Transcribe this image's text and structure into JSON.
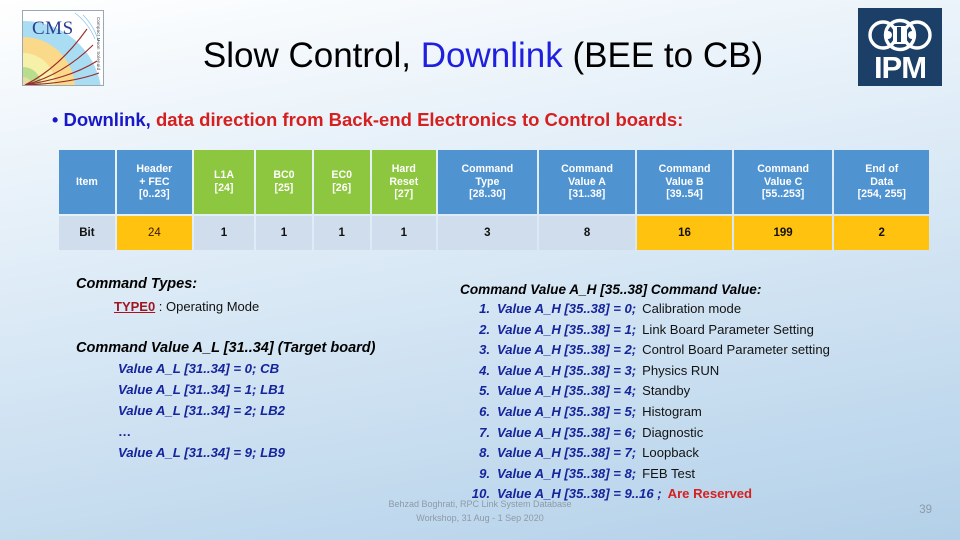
{
  "header": {
    "title_part1": "Slow Control, ",
    "title_highlight": "Downlink",
    "title_part2": " (BEE to CB)",
    "cms_logo_text": "CMS",
    "cms_logo_side_text": "Compact Muon Solenoid",
    "ipm_logo_text": "IPM"
  },
  "bullet": {
    "dot": "•",
    "blue_text": "Downlink,",
    "red_text": "data direction from Back-end Electronics to Control boards:"
  },
  "table": {
    "headers": [
      {
        "lines": [
          "Item"
        ],
        "color": "blue"
      },
      {
        "lines": [
          "Header",
          "+ FEC",
          "[0..23]"
        ],
        "color": "blue"
      },
      {
        "lines": [
          "L1A",
          "[24]"
        ],
        "color": "green"
      },
      {
        "lines": [
          "BC0",
          "[25]"
        ],
        "color": "green"
      },
      {
        "lines": [
          "EC0",
          "[26]"
        ],
        "color": "green"
      },
      {
        "lines": [
          "Hard",
          "Reset",
          "[27]"
        ],
        "color": "green"
      },
      {
        "lines": [
          "Command",
          "Type",
          "[28..30]"
        ],
        "color": "blue"
      },
      {
        "lines": [
          "Command",
          "Value A",
          "[31..38]"
        ],
        "color": "blue"
      },
      {
        "lines": [
          "Command",
          "Value B",
          "[39..54]"
        ],
        "color": "blue"
      },
      {
        "lines": [
          "Command",
          "Value C",
          "[55..253]"
        ],
        "color": "blue"
      },
      {
        "lines": [
          "End of",
          "Data",
          "[254, 255]"
        ],
        "color": "blue"
      }
    ],
    "row_label": "Bit",
    "row_values": [
      "24",
      "1",
      "1",
      "1",
      "1",
      "3",
      "8",
      "16",
      "199",
      "2"
    ],
    "highlighted_cells": [
      0,
      7,
      8,
      9
    ],
    "colors": {
      "header_blue": "#4f93d1",
      "header_green": "#8dc63f",
      "cell_default": "#cfdded",
      "cell_highlight": "#ffc20e"
    }
  },
  "left_block": {
    "heading": "Command Types:",
    "type_label": "TYPE0",
    "type_desc": " : Operating Mode",
    "value_heading": "Command Value A_L [31..34]  (Target board)",
    "values": [
      "Value A_L [31..34] = 0;   CB",
      "Value A_L [31..34] = 1;   LB1",
      "Value A_L [31..34] = 2;   LB2"
    ],
    "ellipsis": "…",
    "last_value": "Value A_L [31..34] = 9;   LB9"
  },
  "right_block": {
    "heading": "Command Value A_H [35..38] Command Value:",
    "items": [
      {
        "num": "1.",
        "code": "Value A_H [35..38] = 0;",
        "desc": "Calibration mode",
        "reserved": false
      },
      {
        "num": "2.",
        "code": "Value A_H [35..38] = 1;",
        "desc": "Link Board Parameter Setting",
        "reserved": false
      },
      {
        "num": "3.",
        "code": "Value A_H [35..38] = 2;",
        "desc": "Control Board Parameter setting",
        "reserved": false
      },
      {
        "num": "4.",
        "code": "Value A_H [35..38] = 3;",
        "desc": "Physics RUN",
        "reserved": false
      },
      {
        "num": "5.",
        "code": "Value A_H [35..38] = 4;",
        "desc": "Standby",
        "reserved": false
      },
      {
        "num": "6.",
        "code": "Value A_H [35..38] = 5;",
        "desc": "Histogram",
        "reserved": false
      },
      {
        "num": "7.",
        "code": "Value A_H [35..38] = 6;",
        "desc": "Diagnostic",
        "reserved": false
      },
      {
        "num": "8.",
        "code": "Value A_H [35..38] = 7;",
        "desc": "Loopback",
        "reserved": false
      },
      {
        "num": "9.",
        "code": "Value A_H [35..38] = 8;",
        "desc": "FEB Test",
        "reserved": false
      },
      {
        "num": "10.",
        "code": "Value A_H [35..38] = 9..16 ;",
        "desc": "Are Reserved",
        "reserved": true
      }
    ]
  },
  "footer": {
    "line1": "Behzad Boghrati, RPC Link System Database",
    "line2": "Workshop, 31 Aug - 1 Sep 2020",
    "page_number": "39"
  }
}
